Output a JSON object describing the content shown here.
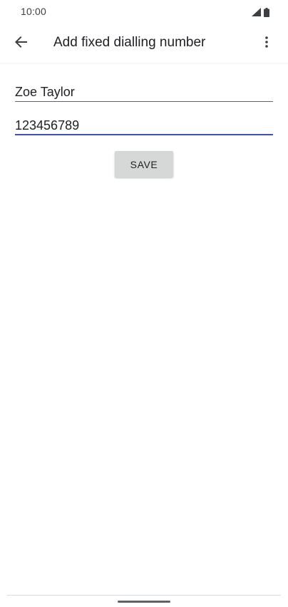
{
  "status_bar": {
    "time": "10:00",
    "icons": [
      "signal-icon",
      "battery-icon"
    ]
  },
  "app_bar": {
    "back_icon": "arrow-left-icon",
    "title": "Add fixed dialling number",
    "overflow_icon": "more-vert-icon"
  },
  "form": {
    "name_value": "Zoe Taylor",
    "number_value": "123456789",
    "save_label": "SAVE"
  },
  "colors": {
    "focus_underline": "#3f51b5",
    "button_bg": "#d6d7d7",
    "text": "#202124"
  }
}
